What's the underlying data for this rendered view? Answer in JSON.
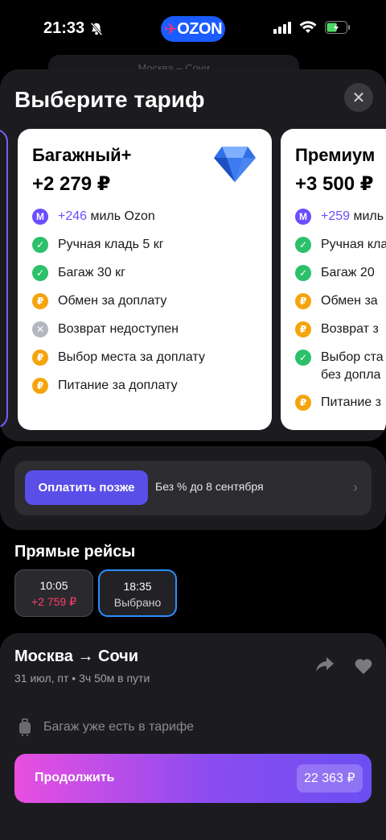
{
  "status_bar": {
    "time": "21:33",
    "brand": "OZON"
  },
  "background_hint": "Москва – Сочи",
  "sheet": {
    "title": "Выберите тариф",
    "tariffs": [
      {
        "name": "Багажный+",
        "price": "+2 279 ₽",
        "features": [
          {
            "icon": "miles-icon",
            "accent": "+246",
            "text": " миль Ozon"
          },
          {
            "icon": "check-icon",
            "text": "Ручная кладь 5 кг"
          },
          {
            "icon": "check-icon",
            "text": "Багаж 30 кг"
          },
          {
            "icon": "ruble-icon",
            "text": "Обмен за доплату"
          },
          {
            "icon": "cross-icon",
            "text": "Возврат недоступен"
          },
          {
            "icon": "ruble-icon",
            "text": "Выбор места за доплату"
          },
          {
            "icon": "ruble-icon",
            "text": "Питание за доплату"
          }
        ]
      },
      {
        "name": "Премиум",
        "price": "+3 500 ₽",
        "features": [
          {
            "icon": "miles-icon",
            "accent": "+259",
            "text": " миль"
          },
          {
            "icon": "check-icon",
            "text": "Ручная кла"
          },
          {
            "icon": "check-icon",
            "text": "Багаж 20"
          },
          {
            "icon": "ruble-icon",
            "text": "Обмен за"
          },
          {
            "icon": "ruble-icon",
            "text": "Возврат з"
          },
          {
            "icon": "check-icon",
            "text": "Выбор ста",
            "text2": "без допла"
          },
          {
            "icon": "ruble-icon",
            "text": "Питание з"
          }
        ]
      }
    ]
  },
  "pay_later": {
    "button": "Оплатить позже",
    "note": "Без % до 8 сентября"
  },
  "flights": {
    "title": "Прямые рейсы",
    "options": [
      {
        "time": "10:05",
        "sub": "+2 759 ₽"
      },
      {
        "time": "18:35",
        "sub": "Выбрано"
      }
    ]
  },
  "route": {
    "title": "Москва → Сочи",
    "details": "31 июл, пт • 3ч 50м в пути",
    "luggage_note": "Багаж уже есть в тарифе"
  },
  "cta": {
    "label": "Продолжить",
    "price": "22 363 ₽"
  },
  "colors": {
    "accent_purple": "#6b4eff",
    "check_green": "#2cc06a",
    "paid_orange": "#f5a40c",
    "selected_blue": "#2d8cff",
    "price_red": "#ff3d6a"
  }
}
